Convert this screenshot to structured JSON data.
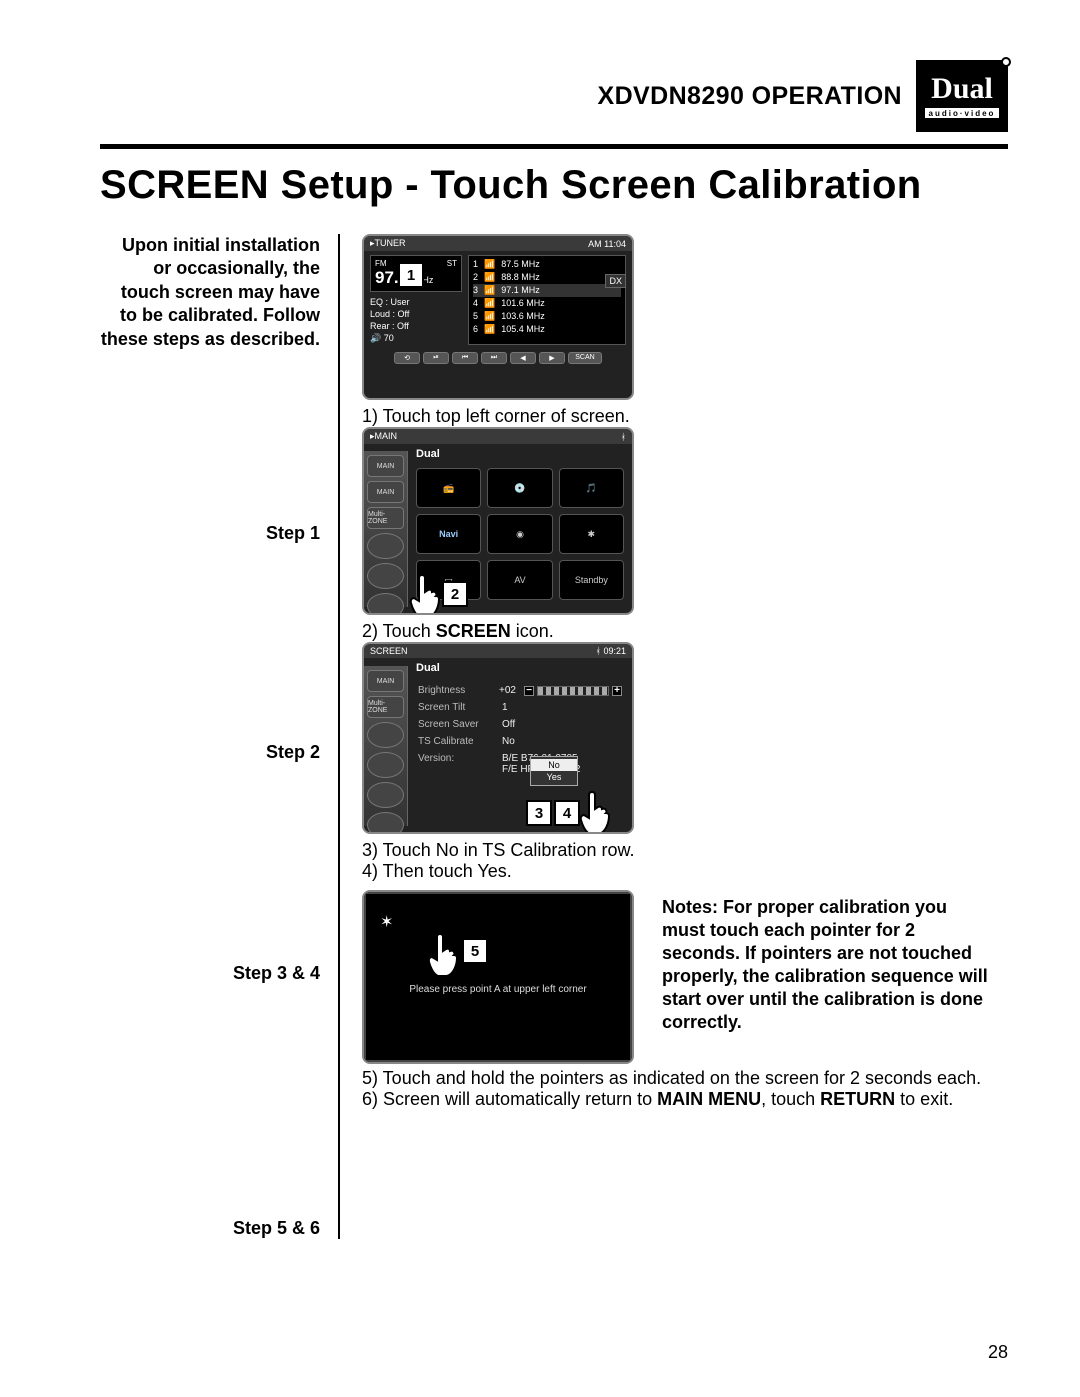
{
  "header": {
    "model": "XDVDN8290",
    "operation": "OPERATION"
  },
  "logo": {
    "brand": "Dual",
    "tag": "audio·video"
  },
  "title": "SCREEN Setup - Touch Screen Calibration",
  "intro": "Upon initial installation or occasionally, the touch screen may have to be calibrated. Follow these steps as described.",
  "steps": {
    "s1_label": "Step 1",
    "s1_text": "1) Touch top left corner of screen.",
    "s2_label": "Step 2",
    "s2_text_pre": "2) Touch ",
    "s2_screen": "SCREEN",
    "s2_text_post": " icon.",
    "s34_label": "Step 3 & 4",
    "s34_line1": "3) Touch No in TS Calibration row.",
    "s34_line2": "4) Then touch Yes.",
    "s56_label": "Step 5 & 6",
    "s56_line1": "5) Touch and hold the pointers as indicated on the screen for 2 seconds each.",
    "s56_line2_pre": "6) Screen will automatically return to ",
    "s56_mm": "MAIN MENU",
    "s56_line2_mid": ", touch ",
    "s56_ret": "RETURN",
    "s56_line2_post": " to exit."
  },
  "notes": "Notes: For proper calibration you must touch each pointer for 2 seconds. If pointers are not touched properly, the calibration sequence will start over until the calibration is done correctly.",
  "page_number": "28",
  "callouts": {
    "c1": "1",
    "c2": "2",
    "c3": "3",
    "c4": "4",
    "c5": "5"
  },
  "tuner_screen": {
    "clock": "AM 11:04",
    "band": "FM",
    "st": "ST",
    "freq": "97.1",
    "unit": "MHz",
    "dx": "DX",
    "eq_label": "EQ",
    "eq_val": ": User",
    "loud_label": "Loud",
    "loud_val": ": Off",
    "rear_label": "Rear",
    "rear_val": ": Off",
    "vol_icon": "🔊",
    "vol_val": "70",
    "presets": [
      {
        "n": "1",
        "f": "87.5 MHz"
      },
      {
        "n": "2",
        "f": "88.8 MHz"
      },
      {
        "n": "3",
        "f": "97.1 MHz",
        "sel": true
      },
      {
        "n": "4",
        "f": "101.6 MHz"
      },
      {
        "n": "5",
        "f": "103.6 MHz"
      },
      {
        "n": "6",
        "f": "105.4 MHz"
      }
    ],
    "strip": [
      "⟲",
      "⏯",
      "⏮",
      "⏭",
      "◀",
      "▶",
      "SCAN"
    ]
  },
  "menu_screen": {
    "clock": "",
    "sidebar": [
      "MAIN",
      "MAIN",
      "Multi-ZONE",
      "○",
      "○",
      "○"
    ],
    "cells": [
      "Radio",
      "Disc",
      "iPod",
      "Navi",
      "Camera",
      "BT",
      "Screen",
      "AV",
      "Standby"
    ],
    "brand": "Dual"
  },
  "screen_settings": {
    "clock": "09:21",
    "title": "SCREEN",
    "brand": "Dual",
    "sidebar": [
      "MAIN",
      "Multi-ZONE",
      "○",
      "○",
      "○",
      "○"
    ],
    "rows": {
      "brightness_l": "Brightness",
      "brightness_v": "+02",
      "tilt_l": "Screen Tilt",
      "tilt_v": "1",
      "saver_l": "Screen Saver",
      "saver_v": "Off",
      "calib_l": "TS Calibrate",
      "calib_v": "No",
      "ver_l": "Version:",
      "ver_v1": "B/E B76.01.0705",
      "ver_v2": "F/E HPD60.09.22"
    },
    "popup": {
      "no": "No",
      "yes": "Yes"
    },
    "slider_minus": "−",
    "slider_plus": "+"
  },
  "calib_screen": {
    "cross": "✶",
    "text": "Please press point A at upper left corner"
  }
}
